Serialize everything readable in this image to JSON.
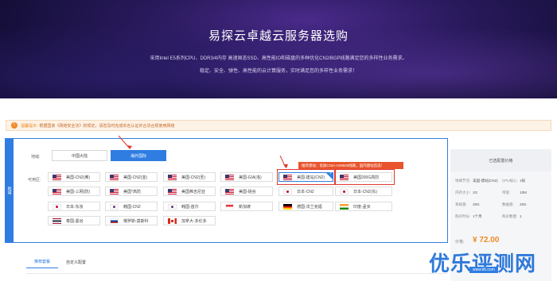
{
  "hero": {
    "title": "易探云卓越云服务器选购",
    "desc_line1": "采用Intel E5系列CPU、DDR3/4内存 高速固态SSD、高性能IO和磁盘的多种优化CN2/BGP线路满足您的多样性业务需求。",
    "desc_line2": "稳定、安全、弹性、高性能的云计算服务，实时满足您的多样性业务需求！"
  },
  "notice": {
    "icon": "warning-icon",
    "label": "温馨提示:",
    "text": "根据国家《网络安全法》的规定，请您及时完成实名认证并合法合规使用网络"
  },
  "panel": {
    "tab_label": "地域",
    "region_label": "地域:",
    "region_mainland": "中国大陆",
    "region_overseas": "海外国际",
    "zone_label": "可用区:",
    "zones": [
      {
        "label": "美国-CN2(弗)",
        "flag": "us"
      },
      {
        "label": "美国-CN2(亚)",
        "flag": "us"
      },
      {
        "label": "美国-CN2(圣)",
        "flag": "us"
      },
      {
        "label": "美国-GIA(洛)",
        "flag": "us"
      },
      {
        "label": "美国-建站(CN2)",
        "flag": "us"
      },
      {
        "label": "美国200G高防",
        "flag": "us"
      },
      {
        "label": "美国-三网(防)",
        "flag": "us"
      },
      {
        "label": "美国*高防",
        "flag": "us"
      },
      {
        "label": "美国弗吉尼亚",
        "flag": "us"
      },
      {
        "label": "美国-硅谷",
        "flag": "us"
      },
      {
        "label": "日本-CN2",
        "flag": "jp"
      },
      {
        "label": "日本-CN2(东)",
        "flag": "jp"
      },
      {
        "label": "日本-东京",
        "flag": "jp"
      },
      {
        "label": "韩国-CN2",
        "flag": "kr"
      },
      {
        "label": "韩国-首尔",
        "flag": "kr"
      },
      {
        "label": "新加坡",
        "flag": "sg"
      },
      {
        "label": "德国-法兰克福",
        "flag": "de"
      },
      {
        "label": "印度-孟买",
        "flag": "in"
      },
      {
        "label": "泰国-曼谷",
        "flag": "th"
      },
      {
        "label": "俄罗斯-莫斯科",
        "flag": "ru"
      },
      {
        "label": "加拿大-多伦多",
        "flag": "ca"
      }
    ],
    "tooltip": "推荐建站：优质CN2+AS9929线路，国内建站首选！"
  },
  "summary": {
    "title": "已选配置价格",
    "rows": [
      {
        "k1": "地域节点:",
        "v1": "美国-建站(CN2)",
        "k2": "CPU核心:",
        "v2": "1核"
      },
      {
        "k1": "内存大小:",
        "v1": "2G",
        "k2": "带宽:",
        "v2": "10M"
      },
      {
        "k1": "系统盘:",
        "v1": "20G",
        "k2": "数据盘:",
        "v2": "20G"
      },
      {
        "k1": "购买时长:",
        "v1": "1个月",
        "k2": "购买数量:",
        "v2": "1"
      }
    ],
    "price_label": "价格:",
    "price": "¥ 72.00"
  },
  "tabs": [
    {
      "label": "推荐套餐"
    },
    {
      "label": "自定义配置"
    }
  ],
  "watermark": {
    "text": "优乐评测网",
    "sub": "www.ii6.com"
  }
}
